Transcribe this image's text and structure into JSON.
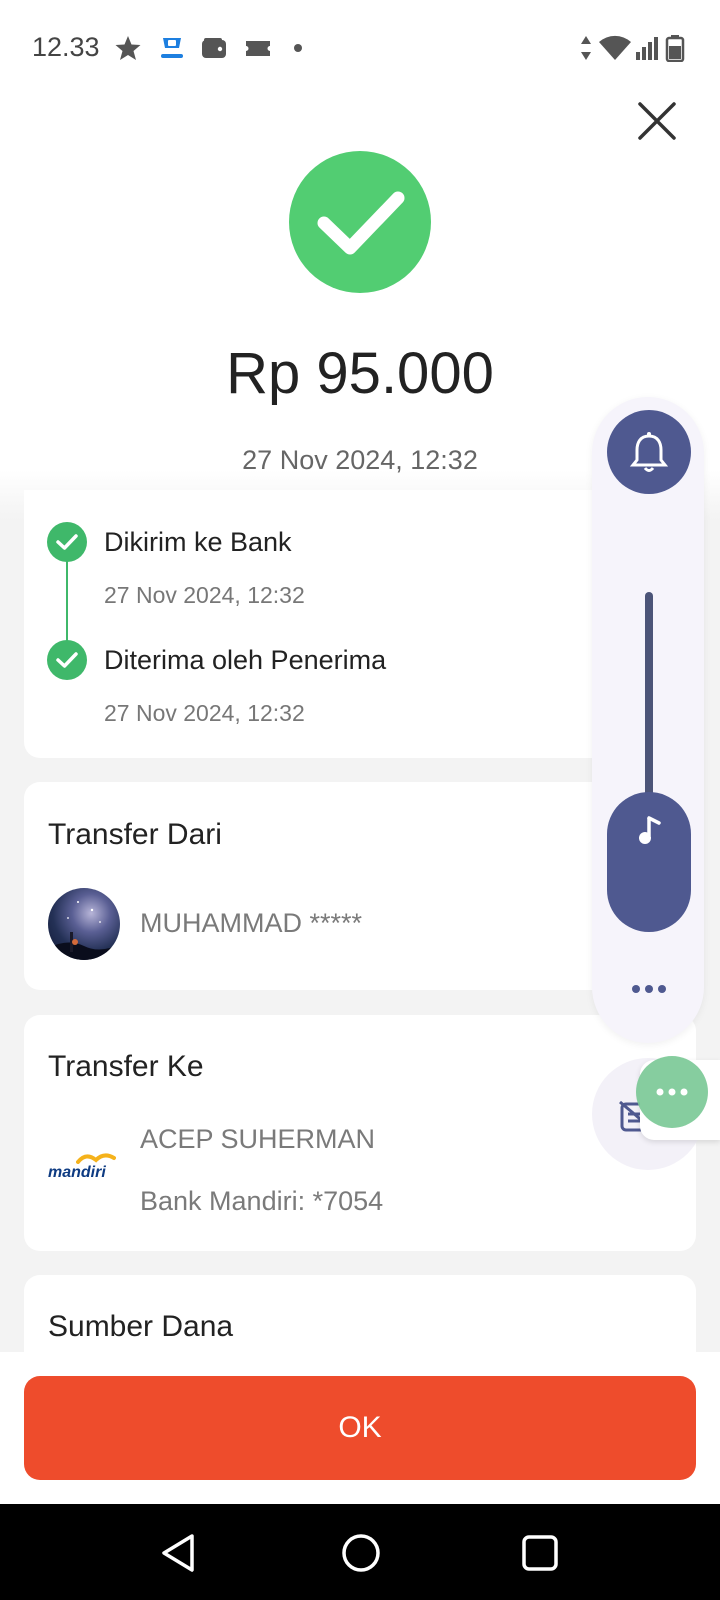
{
  "status_bar": {
    "time": "12.33",
    "icons": [
      "star-icon",
      "app-notification-icon",
      "wallet-icon",
      "ticket-icon",
      "dot-icon"
    ],
    "right_icons": [
      "data-arrows-icon",
      "wifi-icon",
      "signal-icon",
      "battery-icon"
    ]
  },
  "header": {
    "close_icon": "close-icon"
  },
  "transaction": {
    "status_icon": "check-icon",
    "amount": "Rp 95.000",
    "date": "27 Nov 2024, 12:32"
  },
  "timeline": [
    {
      "title": "Dikirim ke Bank",
      "time": "27 Nov 2024, 12:32"
    },
    {
      "title": "Diterima oleh Penerima",
      "time": "27 Nov 2024, 12:32"
    }
  ],
  "transfer_from": {
    "title": "Transfer Dari",
    "name": "MUHAMMAD *****"
  },
  "transfer_to": {
    "title": "Transfer Ke",
    "bank_logo_text": "mandiri",
    "name": "ACEP SUHERMAN",
    "account": "Bank Mandiri: *7054"
  },
  "source_of_funds": {
    "title": "Sumber Dana"
  },
  "ok_button": {
    "label": "OK"
  },
  "volume_panel": {
    "mode_icon": "bell-icon",
    "stream_icon": "music-note-icon",
    "more_icon": "more-dots-icon"
  },
  "colors": {
    "success": "#52cd72",
    "primary": "#ee4c2c",
    "timeline": "#3fb86a",
    "volume": "#4f5990"
  }
}
